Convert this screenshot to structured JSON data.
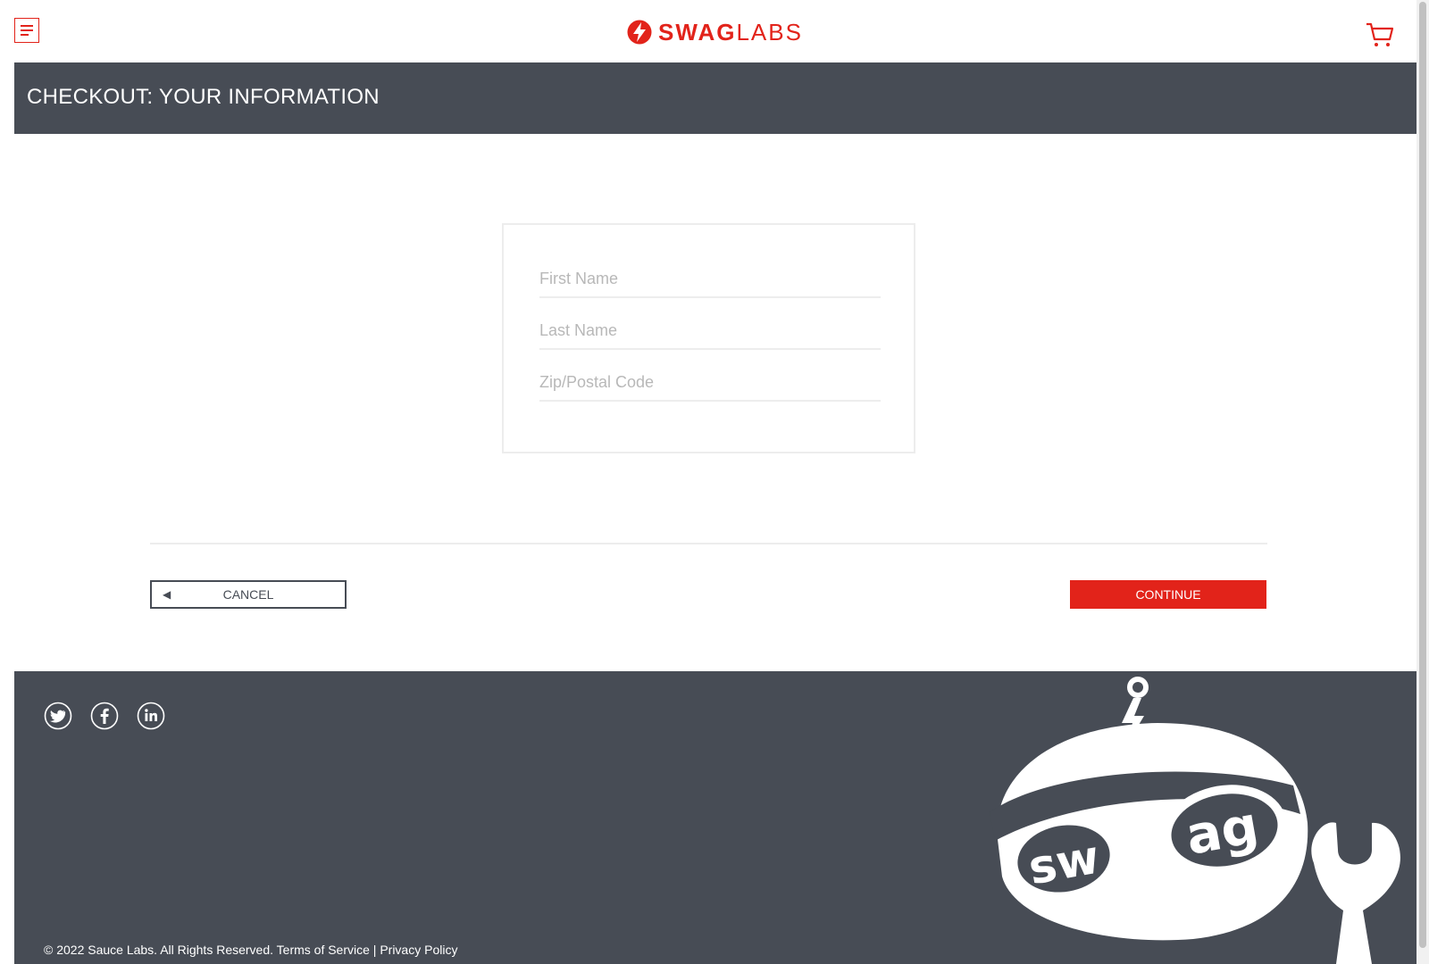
{
  "header": {
    "logo_bold": "SWAG",
    "logo_light": "LABS"
  },
  "page_title": "CHECKOUT: YOUR INFORMATION",
  "form": {
    "first_name_placeholder": "First Name",
    "last_name_placeholder": "Last Name",
    "zip_placeholder": "Zip/Postal Code",
    "first_name_value": "",
    "last_name_value": "",
    "zip_value": ""
  },
  "actions": {
    "cancel_label": "CANCEL",
    "continue_label": "CONTINUE"
  },
  "footer": {
    "social": [
      "twitter-icon",
      "facebook-icon",
      "linkedin-icon"
    ],
    "copyright": "© 2022 Sauce Labs. All Rights Reserved. Terms of Service | Privacy Policy"
  },
  "colors": {
    "brand_red": "#e2231a",
    "dark_bar": "#474c55"
  }
}
